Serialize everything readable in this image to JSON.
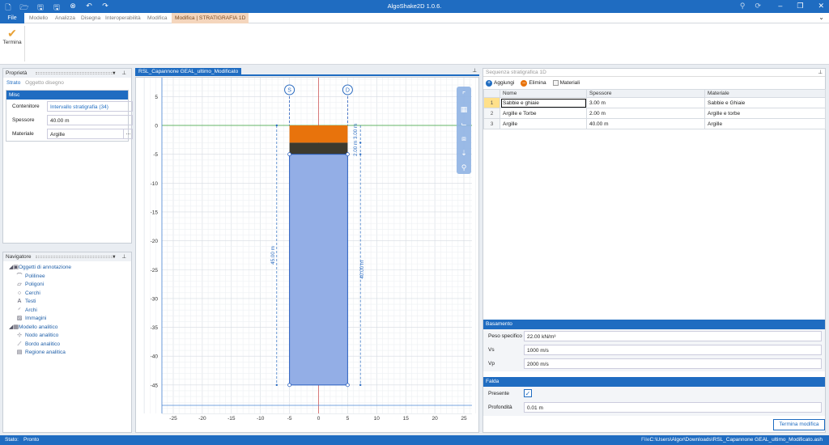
{
  "app": {
    "title": "AlgoShake2D 1.0.6."
  },
  "ribbon_tabs": {
    "file": "File",
    "tabs": [
      "Modello",
      "Analizza",
      "Disegna",
      "Interoperabilità",
      "Modifica"
    ],
    "context": "Modifica | STRATIGRAFIA 1D"
  },
  "ribbon": {
    "termina": "Termina"
  },
  "properties": {
    "title": "Proprietà",
    "subtab_active": "Strato",
    "subtab_other": "Oggetto disegno",
    "section": "Misc",
    "rows": [
      {
        "key": "Contenitore",
        "value": "Intervallo stratigrafia (34)"
      },
      {
        "key": "Spessore",
        "value": "40.00 m"
      },
      {
        "key": "Materiale",
        "value": "Argille"
      }
    ],
    "ellipsis": "..."
  },
  "navigator": {
    "title": "Navigatore",
    "items": [
      {
        "label": "Oggetti di annotazione",
        "icon": "annotation-icon",
        "level": 1
      },
      {
        "label": "Polilinee",
        "icon": "polyline-icon",
        "level": 2
      },
      {
        "label": "Poligoni",
        "icon": "polygon-icon",
        "level": 2
      },
      {
        "label": "Cerchi",
        "icon": "circle-icon",
        "level": 2
      },
      {
        "label": "Testi",
        "icon": "text-icon",
        "level": 2
      },
      {
        "label": "Archi",
        "icon": "arc-icon",
        "level": 2
      },
      {
        "label": "Immagini",
        "icon": "image-icon",
        "level": 2
      },
      {
        "label": "Modello analitico",
        "icon": "model-icon",
        "level": 1
      },
      {
        "label": "Nodo analitico",
        "icon": "node-icon",
        "level": 2
      },
      {
        "label": "Bordo analitico",
        "icon": "edge-icon",
        "level": 2
      },
      {
        "label": "Regione analitica",
        "icon": "region-icon",
        "level": 2
      }
    ]
  },
  "document": {
    "tab": "RSL_Capannone GEAL_ultimo_Modificato"
  },
  "drawing": {
    "xticks": [
      "-25",
      "-20",
      "-15",
      "-10",
      "-5",
      "0",
      "5",
      "10",
      "15",
      "20",
      "25"
    ],
    "yticks": [
      "5",
      "0",
      "-5",
      "-10",
      "-15",
      "-20",
      "-25",
      "-30",
      "-35",
      "-40",
      "-45"
    ],
    "dim_total": "45.00 m",
    "dim_layer": "40.00 m",
    "dim_top": "2.00 m 3.00 m",
    "marker_left": "S",
    "marker_right": "D",
    "layer_colors": [
      "#e8730c",
      "#3d3a2e",
      "#93aee6"
    ]
  },
  "sequence": {
    "title": "Sequenza stratigrafica 1D",
    "tools": {
      "add": "Aggiungi",
      "delete": "Elimina",
      "materials": "Materiali"
    },
    "columns": [
      "Nome",
      "Spessore",
      "Materiale"
    ],
    "rows": [
      {
        "n": "1",
        "name": "Sabbie e ghiaie",
        "thick": "3.00 m",
        "mat": "Sabbie e Ghiaie"
      },
      {
        "n": "2",
        "name": "Argille e Torbe",
        "thick": "2.00 m",
        "mat": "Argille e torbe"
      },
      {
        "n": "3",
        "name": "Argille",
        "thick": "40.00 m",
        "mat": "Argille"
      }
    ]
  },
  "basamento": {
    "title": "Basamento",
    "rows": [
      {
        "key": "Peso specifico",
        "value": "22.00 kN/m³"
      },
      {
        "key": "Vs",
        "value": "1000 m/s"
      },
      {
        "key": "Vp",
        "value": "2000 m/s"
      }
    ]
  },
  "falda": {
    "title": "Falda",
    "present": "Presente",
    "depth_key": "Profondità",
    "depth": "0.01 m"
  },
  "buttons": {
    "termina_modifica": "Termina modifica"
  },
  "status": {
    "label": "Stato:",
    "value": "Pronto",
    "file_label": "File:",
    "file": "C:\\Users\\Algor\\Downloads\\RSL_Capannone GEAL_ultimo_Modificato.ash"
  }
}
